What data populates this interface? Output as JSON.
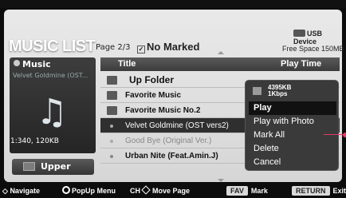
{
  "header": {
    "title": "MUSIC LIST",
    "page_info": "Page 2/3",
    "marked_label": "No Marked",
    "usb_label": "USB Device",
    "free_space": "Free Space 150MB"
  },
  "left_panel": {
    "category": "Music",
    "track_title": "Velvet Goldmine (OST...",
    "file_info": "1:340, 120KB",
    "upper_label": "Upper"
  },
  "table": {
    "col_title": "Title",
    "col_playtime": "Play Time",
    "rows": [
      {
        "label": "Up Folder"
      },
      {
        "label": "Favorite Music"
      },
      {
        "label": "Favorite Music No.2"
      },
      {
        "label": "Velvet Goldmine (OST vers2)"
      },
      {
        "label": "Good Bye (Original Ver.)"
      },
      {
        "label": "Urban Nite (Feat.Amin.J)"
      }
    ]
  },
  "popup": {
    "size": "4395KB",
    "bitrate": "1Kbps",
    "items": [
      "Play",
      "Play with Photo",
      "Mark All",
      "Delete",
      "Cancel"
    ]
  },
  "footer": {
    "navigate": "Navigate",
    "popup_menu": "PopUp Menu",
    "ch": "CH",
    "move_page": "Move Page",
    "fav_key": "FAV",
    "mark": "Mark",
    "return_key": "RETURN",
    "exit": "Exit"
  },
  "colors": {
    "accent": "#e43b67",
    "panel": "#e0e0e0",
    "dark": "#2f2f2f"
  }
}
